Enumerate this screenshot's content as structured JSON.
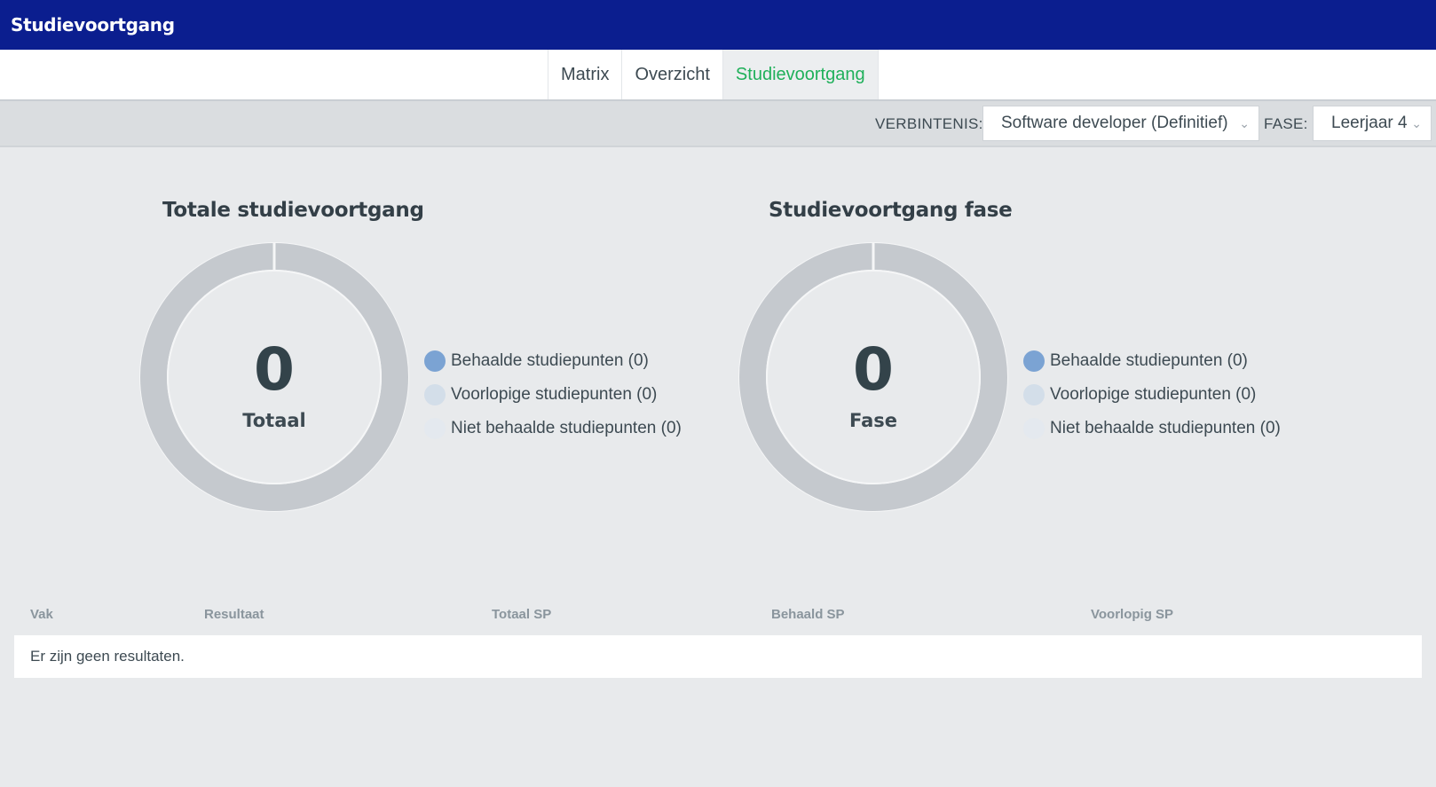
{
  "app": {
    "title": "Studievoortgang"
  },
  "tabs": [
    {
      "label": "Matrix",
      "active": false
    },
    {
      "label": "Overzicht",
      "active": false
    },
    {
      "label": "Studievoortgang",
      "active": true
    }
  ],
  "filters": {
    "verbintenis_label": "VERBINTENIS:",
    "verbintenis_value": "Software developer (Definitief)",
    "fase_label": "FASE:",
    "fase_value": "Leerjaar 4"
  },
  "colors": {
    "header": "#0b1e8f",
    "active_tab": "#1fb05a",
    "behaald": "#7ba3d3",
    "voorlopig": "#d3dee9",
    "niet_behaald": "#e4e9ef",
    "donut_ring": "#c5c9ce"
  },
  "charts": [
    {
      "title": "Totale studievoortgang",
      "value": "0",
      "center_label": "Totaal",
      "legend": [
        {
          "label": "Behaalde studiepunten (0)",
          "color": "#7ba3d3"
        },
        {
          "label": "Voorlopige studiepunten (0)",
          "color": "#d3dee9"
        },
        {
          "label": "Niet behaalde studiepunten (0)",
          "color": "#e4e9ef"
        }
      ]
    },
    {
      "title": "Studievoortgang fase",
      "value": "0",
      "center_label": "Fase",
      "legend": [
        {
          "label": "Behaalde studiepunten (0)",
          "color": "#7ba3d3"
        },
        {
          "label": "Voorlopige studiepunten (0)",
          "color": "#d3dee9"
        },
        {
          "label": "Niet behaalde studiepunten (0)",
          "color": "#e4e9ef"
        }
      ]
    }
  ],
  "table": {
    "columns": [
      "Vak",
      "Resultaat",
      "Totaal SP",
      "Behaald SP",
      "Voorlopig SP"
    ],
    "empty_message": "Er zijn geen resultaten."
  }
}
